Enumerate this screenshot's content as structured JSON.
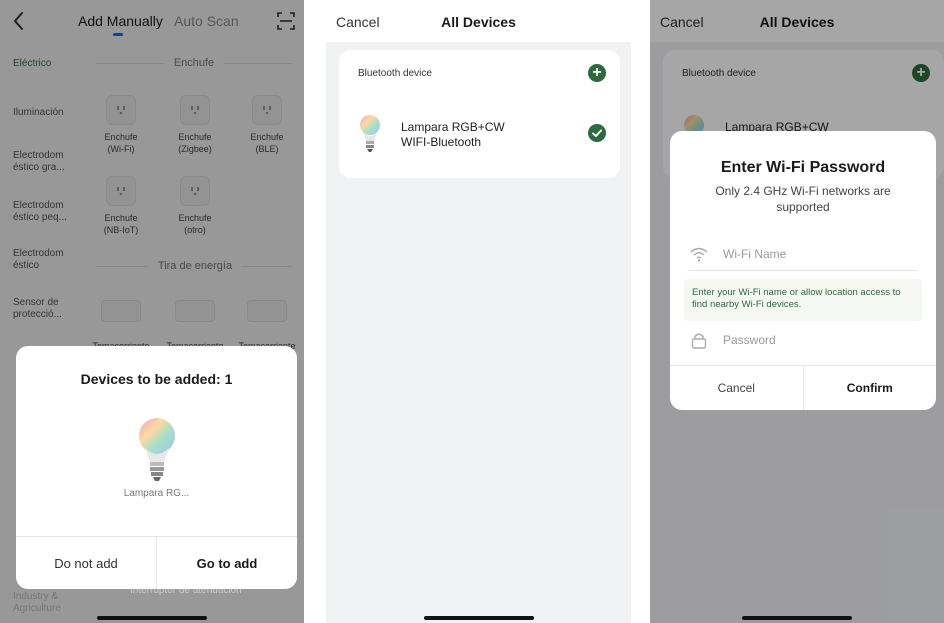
{
  "phone1": {
    "tabs": {
      "manual": "Add Manually",
      "auto": "Auto Scan"
    },
    "categories": [
      "Eléctrico",
      "Iluminación",
      "Electrodom éstico gra...",
      "Electrodom éstico peq...",
      "Electrodom éstico",
      "Sensor de protecció...",
      "Industry & Agriculture"
    ],
    "section_enchufe": "Enchufe",
    "section_tira": "Tira de energía",
    "devices": [
      {
        "name": "Enchufe",
        "sub": "(Wi-Fi)"
      },
      {
        "name": "Enchufe",
        "sub": "(Zigbee)"
      },
      {
        "name": "Enchufe",
        "sub": "(BLE)"
      },
      {
        "name": "Enchufe",
        "sub": "(NB-IoT)"
      },
      {
        "name": "Enchufe",
        "sub": "(otro)"
      }
    ],
    "strips": [
      "Tomacorriente",
      "Tomacorriente",
      "Tomacorriente"
    ],
    "under_text": "Interruptor de atenuación",
    "sheet": {
      "title": "Devices to be added: 1",
      "device_name": "Lampara RG...",
      "btn_no": "Do not add",
      "btn_go": "Go to add"
    }
  },
  "phone2": {
    "nav": {
      "cancel": "Cancel",
      "title": "All Devices"
    },
    "card": {
      "header": "Bluetooth device",
      "add_symbol": "+",
      "device_line1": "Lampara RGB+CW",
      "device_line2": "WIFI-Bluetooth"
    }
  },
  "phone3": {
    "nav": {
      "cancel": "Cancel",
      "title": "All Devices"
    },
    "card": {
      "header": "Bluetooth device",
      "add_symbol": "+",
      "device_line1": "Lampara RGB+CW"
    },
    "modal": {
      "title": "Enter Wi-Fi Password",
      "subtitle": "Only 2.4 GHz Wi-Fi networks are supported",
      "wifi_placeholder": "Wi-Fi Name",
      "hint": "Enter your Wi-Fi name or allow location access to find nearby Wi-Fi devices.",
      "password_placeholder": "Password",
      "cancel": "Cancel",
      "confirm": "Confirm"
    }
  },
  "colors": {
    "accent_green": "#2d6b3e",
    "tab_underline": "#2a6bdc"
  }
}
